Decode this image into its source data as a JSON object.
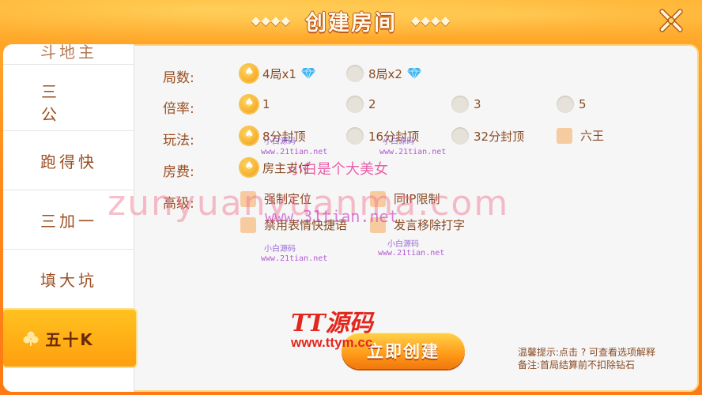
{
  "header": {
    "title": "创建房间",
    "deco_left": "◆◆◆◆",
    "deco_right": "◆◆◆◆"
  },
  "sidebar": {
    "items": [
      {
        "label": "斗地主",
        "state": "partial"
      },
      {
        "label": "三公",
        "state": "normal"
      },
      {
        "label": "跑得快",
        "state": "normal"
      },
      {
        "label": "三加一",
        "state": "normal"
      },
      {
        "label": "填大坑",
        "state": "normal"
      },
      {
        "label": "五十K",
        "state": "selected"
      }
    ]
  },
  "settings": {
    "rounds": {
      "label": "局数:",
      "options": [
        {
          "label": "4局x1",
          "selected": true,
          "gem": true
        },
        {
          "label": "8局x2",
          "selected": false,
          "gem": true
        }
      ]
    },
    "multiplier": {
      "label": "倍率:",
      "options": [
        {
          "label": "1",
          "selected": true
        },
        {
          "label": "2",
          "selected": false
        },
        {
          "label": "3",
          "selected": false
        },
        {
          "label": "5",
          "selected": false
        }
      ]
    },
    "play": {
      "label": "玩法:",
      "options": [
        {
          "label": "8分封顶",
          "selected": true
        },
        {
          "label": "16分封顶",
          "selected": false
        },
        {
          "label": "32分封顶",
          "selected": false
        }
      ],
      "checkbox": {
        "label": "六王",
        "checked": false
      }
    },
    "fee": {
      "label": "房费:",
      "options": [
        {
          "label": "房主支付",
          "selected": true
        }
      ]
    },
    "advanced": {
      "label": "高级:",
      "checkboxes": [
        {
          "label": "强制定位",
          "checked": false
        },
        {
          "label": "同IP限制",
          "checked": false
        },
        {
          "label": "禁用表情快捷语",
          "checked": false
        },
        {
          "label": "发言移除打字",
          "checked": false
        }
      ]
    }
  },
  "buttons": {
    "create": "立即创建"
  },
  "tips": {
    "line1": "温馨提示:点击 ? 可查看选项解释",
    "line2": "备注:首局结算前不扣除钻石"
  },
  "watermarks": {
    "big": "zunyuanyuanma.com",
    "pink": "小白是个大美女",
    "site_mid": "www.31tian.net",
    "small_1": "小白源码",
    "small_1_url": "www.21tian.net",
    "small_2": "小白源码",
    "small_2_url": "www.21tian.net",
    "small_3": "小白源码",
    "small_3_url": "www.21tian.net",
    "small_4": "小白源码",
    "small_4_url": "www.21tian.net",
    "tt_logo": "TT源码",
    "tt_url": "www.ttym.cc"
  },
  "colors": {
    "accent_orange": "#ff9a18",
    "label_brown": "#9a4f22",
    "selected_tab": "#ffc21f"
  }
}
